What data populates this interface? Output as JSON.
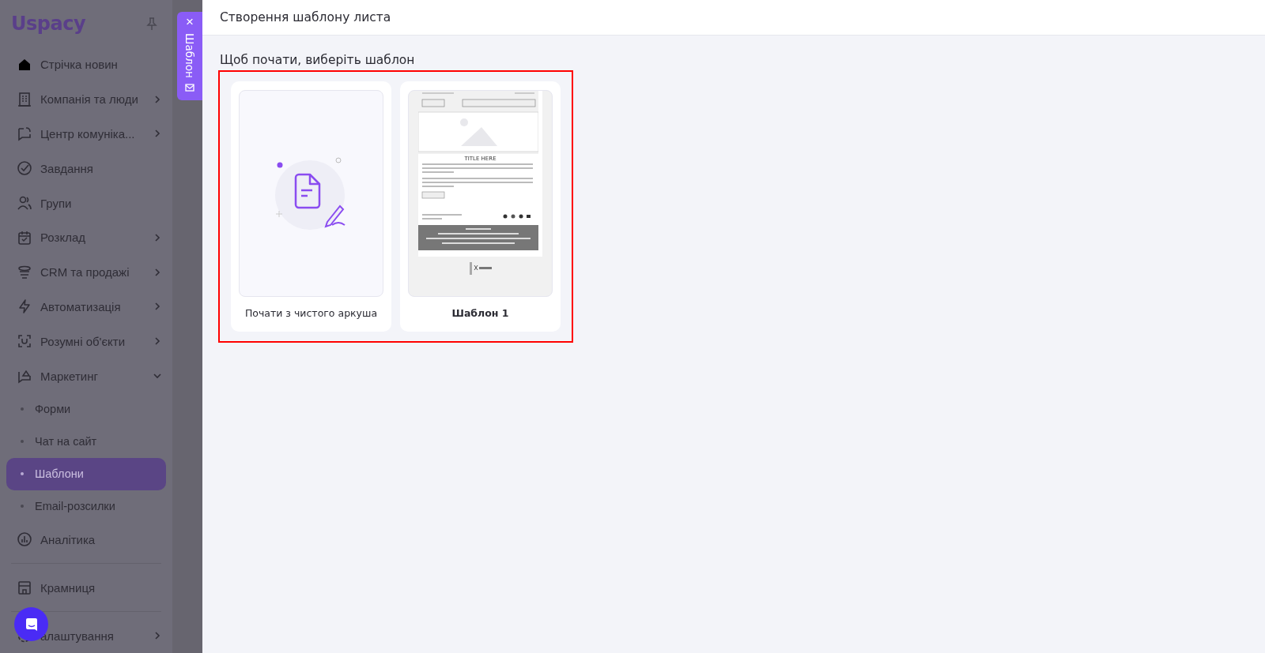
{
  "sidebar": {
    "logo": "Uspacy",
    "items": [
      {
        "label": "Стрічка новин"
      },
      {
        "label": "Компанія та люди",
        "expanded": false
      },
      {
        "label": "Центр комуніка...",
        "expanded": false
      },
      {
        "label": "Завдання"
      },
      {
        "label": "Групи"
      },
      {
        "label": "Розклад",
        "expanded": false
      },
      {
        "label": "CRM та продажі",
        "expanded": false
      },
      {
        "label": "Автоматизація",
        "expanded": false
      },
      {
        "label": "Розумні об'єкти",
        "expanded": false
      },
      {
        "label": "Маркетинг",
        "expanded": true,
        "children": [
          {
            "label": "Форми",
            "selected": false
          },
          {
            "label": "Чат на сайт",
            "selected": false
          },
          {
            "label": "Шаблони",
            "selected": true
          },
          {
            "label": "Email-розсилки",
            "selected": false
          }
        ]
      },
      {
        "label": "Аналітика"
      }
    ],
    "bottom_items": [
      {
        "label": "Крамниця"
      },
      {
        "label": "алаштування",
        "expanded": false
      }
    ]
  },
  "side_tab": {
    "close": "×",
    "label": "Шаблон"
  },
  "header": {
    "title": "Створення шаблону листа"
  },
  "content": {
    "prompt": "Щоб почати, виберіть шаблон",
    "templates": [
      {
        "kind": "blank",
        "label": "Почати з чистого аркуша"
      },
      {
        "kind": "email",
        "label": "Шаблон 1",
        "preview_title": "TITLE HERE"
      }
    ]
  }
}
